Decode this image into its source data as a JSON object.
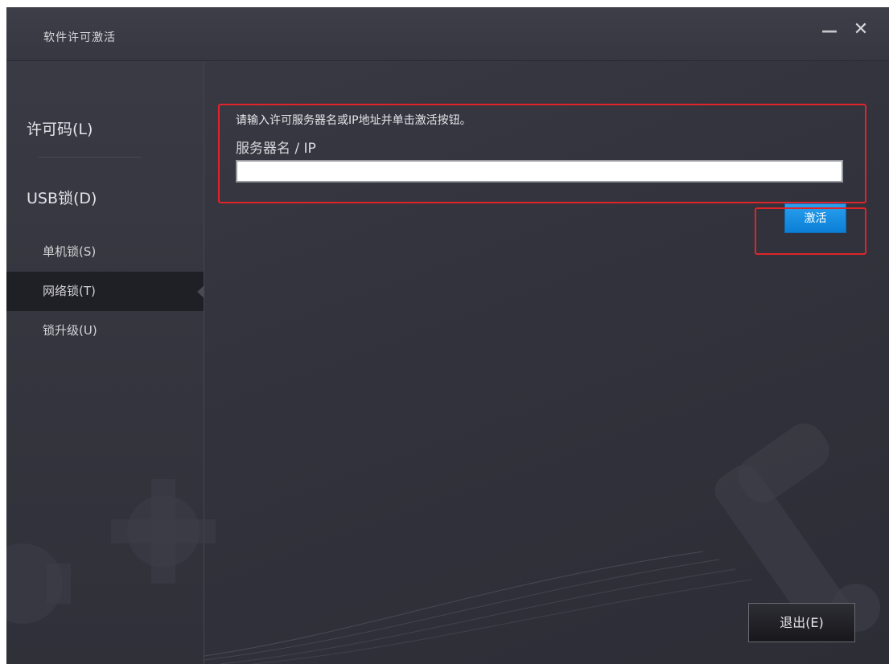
{
  "window": {
    "title": "软件许可激活",
    "minimize_label": "—",
    "close_label": "✕"
  },
  "sidebar": {
    "license_code": "许可码(L)",
    "usb_lock": "USB锁(D)",
    "items": [
      {
        "label": "单机锁(S)",
        "active": false
      },
      {
        "label": "网络锁(T)",
        "active": true
      },
      {
        "label": "锁升级(U)",
        "active": false
      }
    ]
  },
  "main": {
    "prompt": "请输入许可服务器名或IP地址并单击激活按钮。",
    "field_label": "服务器名 / IP",
    "server_value": "",
    "activate_label": "激活",
    "exit_label": "退出(E)"
  },
  "colors": {
    "accent": "#1a8ee4",
    "highlight": "#e0242a",
    "background": "#35353f"
  }
}
